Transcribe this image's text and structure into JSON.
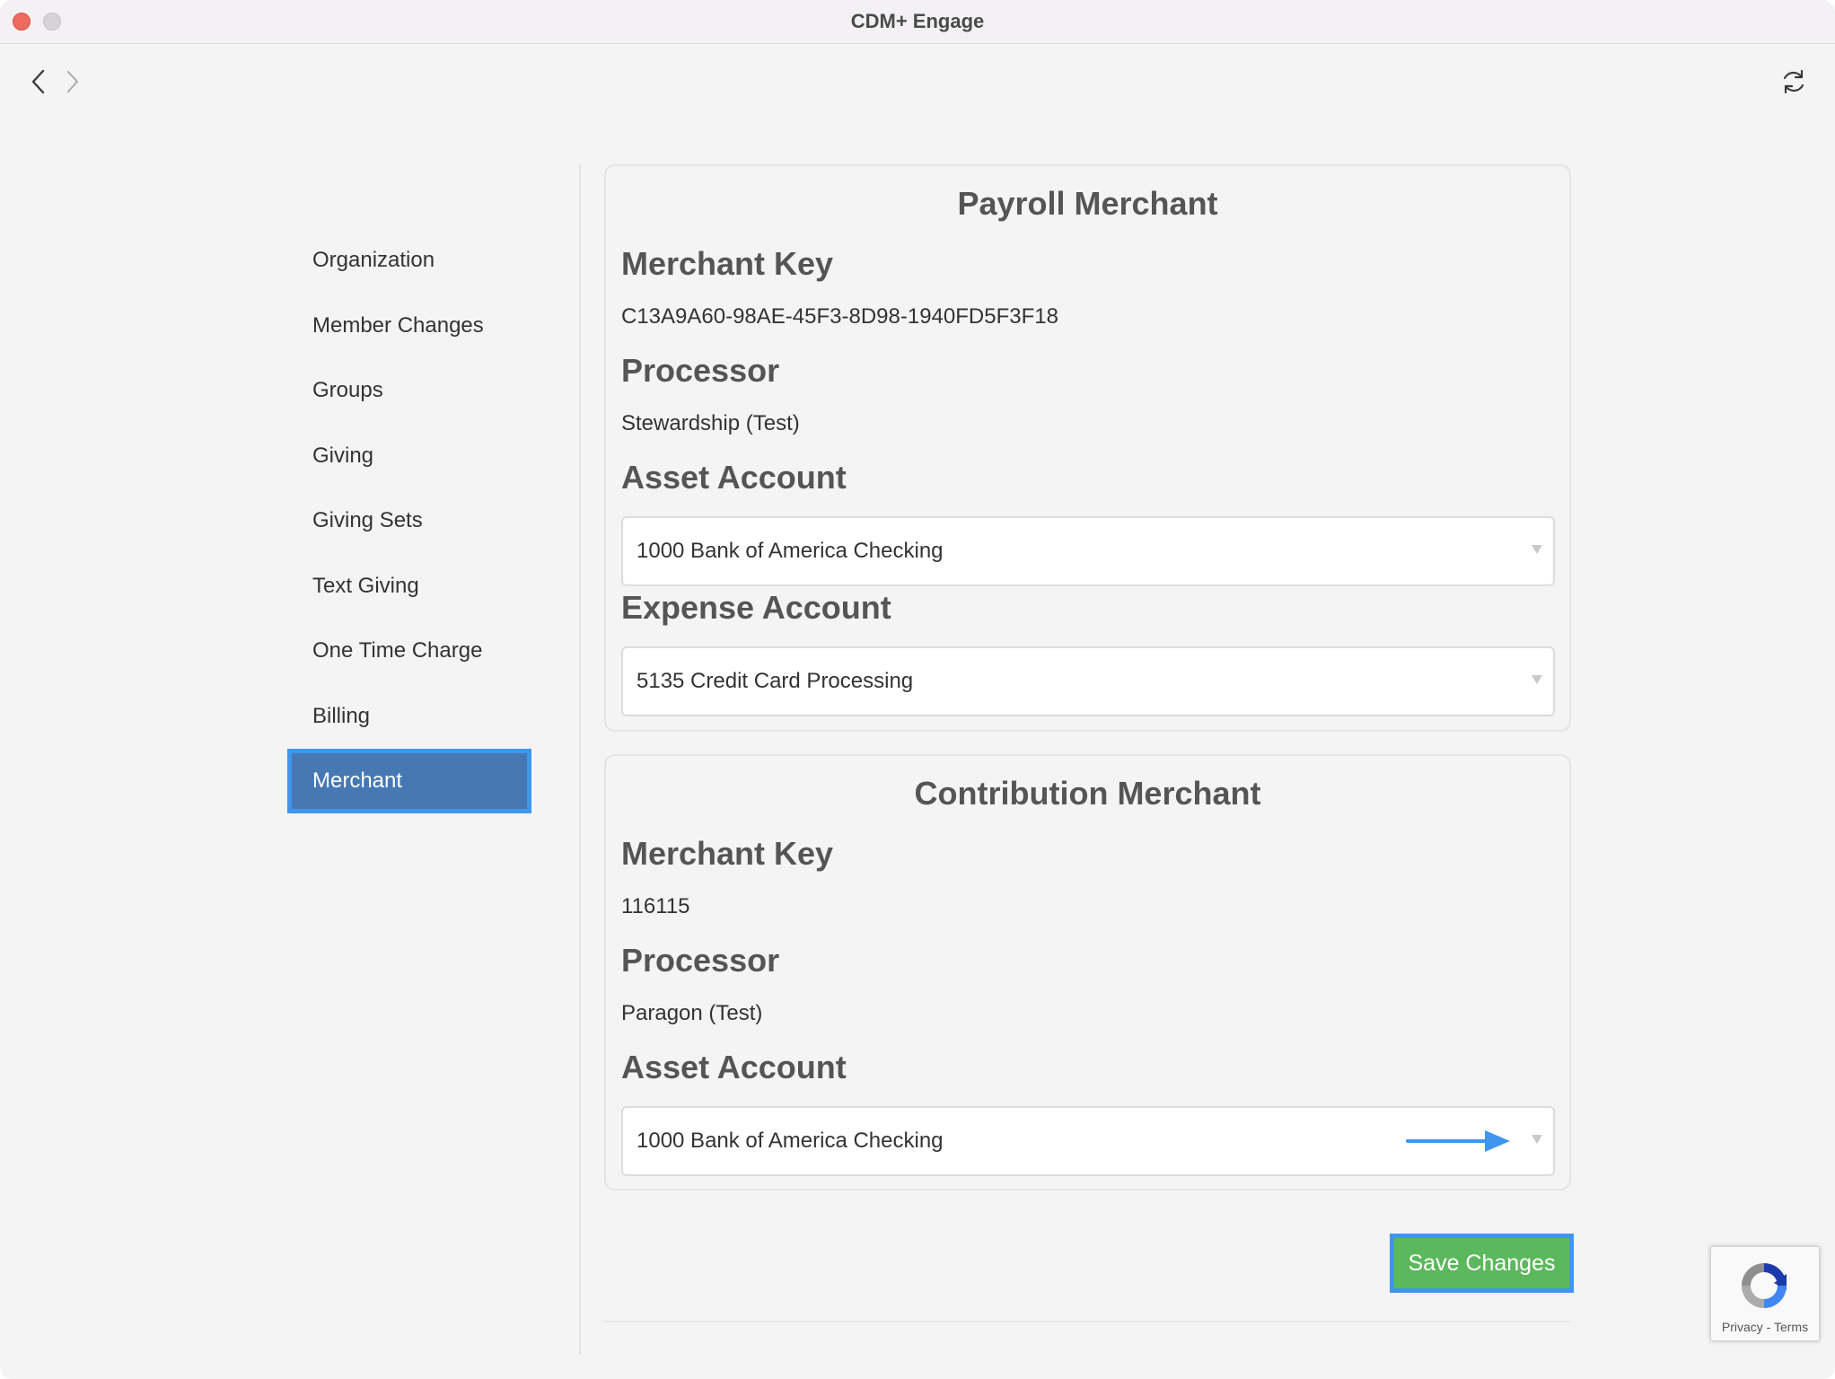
{
  "window": {
    "title": "CDM+ Engage"
  },
  "sidebar": {
    "items": [
      {
        "label": "Organization"
      },
      {
        "label": "Member Changes"
      },
      {
        "label": "Groups"
      },
      {
        "label": "Giving"
      },
      {
        "label": "Giving Sets"
      },
      {
        "label": "Text Giving"
      },
      {
        "label": "One Time Charge"
      },
      {
        "label": "Billing"
      },
      {
        "label": "Merchant",
        "active": true
      }
    ]
  },
  "payroll": {
    "title": "Payroll Merchant",
    "merchant_key_label": "Merchant Key",
    "merchant_key": "C13A9A60-98AE-45F3-8D98-1940FD5F3F18",
    "processor_label": "Processor",
    "processor": "Stewardship (Test)",
    "asset_account_label": "Asset Account",
    "asset_account": "1000 Bank of America Checking",
    "expense_account_label": "Expense Account",
    "expense_account": "5135 Credit Card Processing"
  },
  "contribution": {
    "title": "Contribution Merchant",
    "merchant_key_label": "Merchant Key",
    "merchant_key": "116115",
    "processor_label": "Processor",
    "processor": "Paragon (Test)",
    "asset_account_label": "Asset Account",
    "asset_account": "1000 Bank of America Checking"
  },
  "actions": {
    "save_label": "Save Changes"
  },
  "recaptcha": {
    "privacy": "Privacy",
    "separator": " - ",
    "terms": "Terms"
  },
  "colors": {
    "accent": "#4678b4",
    "highlight": "#3f96ef",
    "save": "#5cb85c",
    "close": "#ed6a5e"
  },
  "icons": [
    "back-icon",
    "forward-icon",
    "refresh-icon",
    "chevron-down-icon",
    "arrow-right-icon",
    "recaptcha-icon"
  ]
}
